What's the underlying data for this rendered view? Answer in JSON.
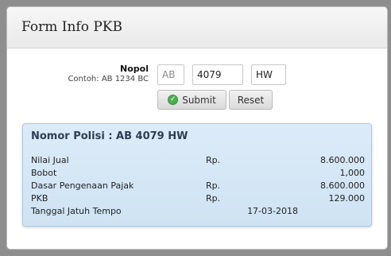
{
  "panel": {
    "title": "Form Info PKB"
  },
  "form": {
    "label": "Nopol",
    "hint": "Contoh: AB 1234 BC",
    "prefix": {
      "value": "",
      "placeholder": "AB"
    },
    "number": {
      "value": "4079",
      "placeholder": ""
    },
    "suffix": {
      "value": "HW",
      "placeholder": ""
    },
    "submit_label": "Submit",
    "submit_icon": "check-circle-icon",
    "reset_label": "Reset"
  },
  "result": {
    "title": "Nomor Polisi : AB 4079 HW",
    "rows": [
      {
        "label": "Nilai Jual",
        "currency": "Rp.",
        "value": "8.600.000"
      },
      {
        "label": "Bobot",
        "currency": "",
        "value": "1,000"
      },
      {
        "label": "Dasar Pengenaan Pajak",
        "currency": "Rp.",
        "value": "8.600.000"
      },
      {
        "label": "PKB",
        "currency": "Rp.",
        "value": "129.000"
      }
    ],
    "due": {
      "label": "Tanggal Jatuh Tempo",
      "value": "17-03-2018"
    }
  },
  "colors": {
    "result_bg": "#dcebf8",
    "result_border": "#a9c9e6",
    "submit_icon": "#4caf50"
  }
}
